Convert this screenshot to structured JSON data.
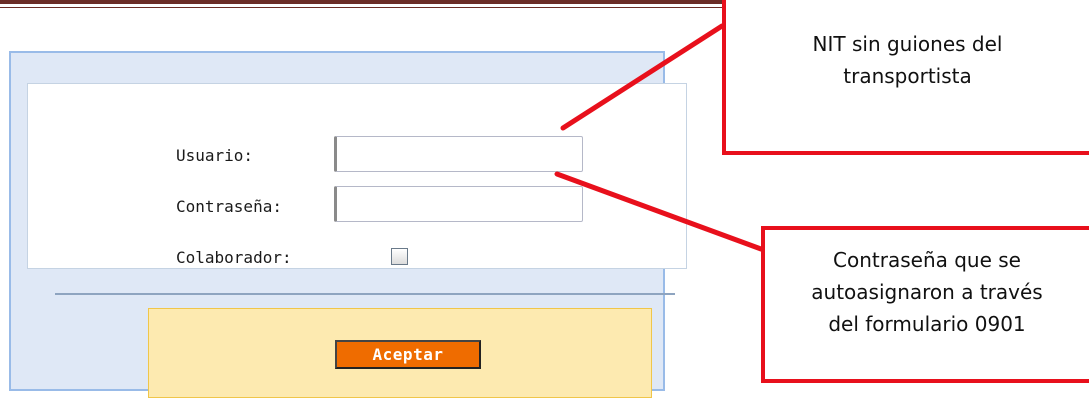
{
  "login_form": {
    "usuario_label": "Usuario:",
    "usuario_value": "",
    "contrasena_label": "Contraseña:",
    "contrasena_value": "",
    "colaborador_label": "Colaborador:",
    "colaborador_checked": false,
    "accept_button_label": "Aceptar"
  },
  "annotations": {
    "usuario_note": "NIT sin guiones del\ntransportista",
    "contrasena_note": "Contraseña que se\nautoasignaron a través\ndel formulario 0901"
  },
  "colors": {
    "callout_border": "#e8101c",
    "panel_background": "#dfe8f6",
    "panel_border": "#99bbe8",
    "footer_background": "#fdeab0",
    "button_background": "#ef6c00",
    "document_rule": "#6b2d27"
  }
}
